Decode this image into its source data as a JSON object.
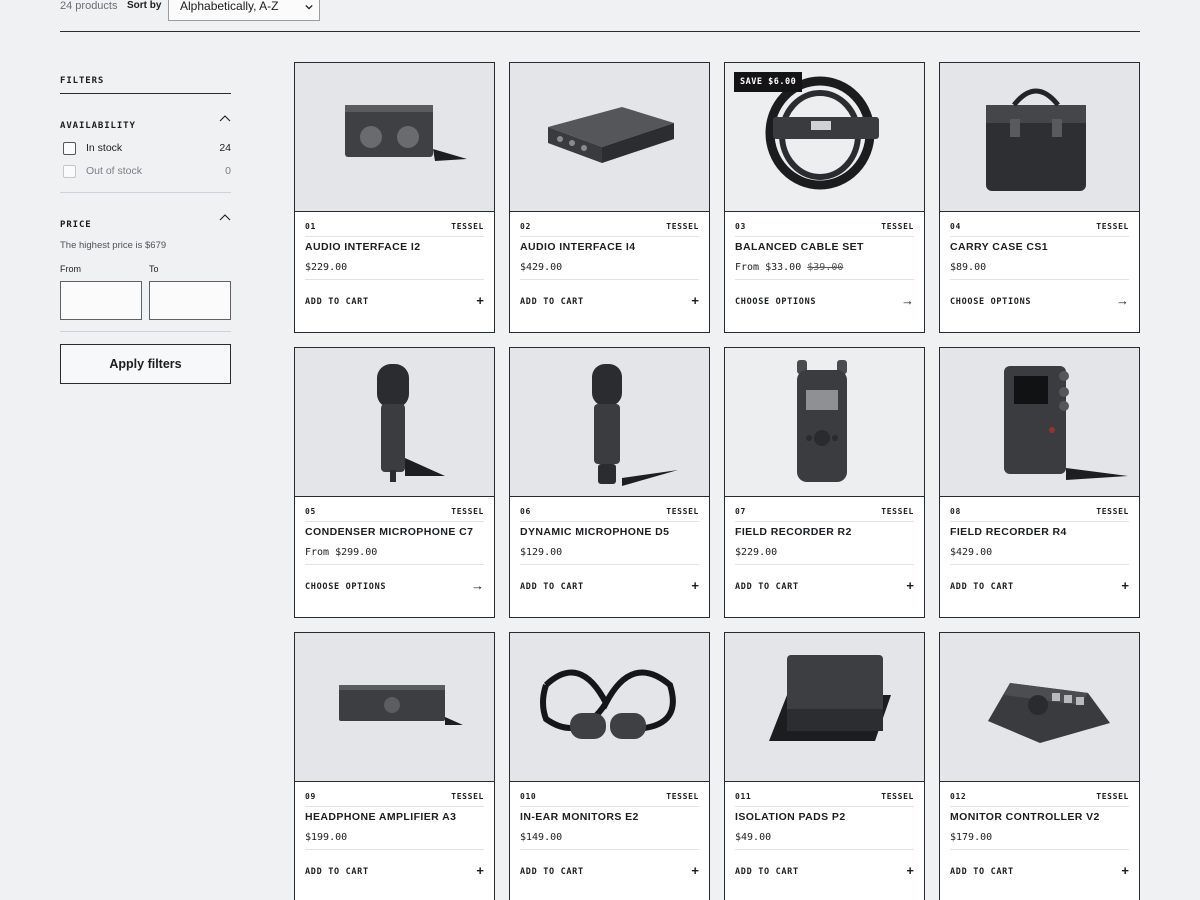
{
  "toolbar": {
    "product_count": "24 products",
    "sort_label": "Sort by",
    "sort_value": "Alphabetically, A-Z"
  },
  "filters": {
    "title": "FILTERS",
    "availability": {
      "title": "AVAILABILITY",
      "options": [
        {
          "label": "In stock",
          "count": "24"
        },
        {
          "label": "Out of stock",
          "count": "0"
        }
      ]
    },
    "price": {
      "title": "PRICE",
      "highest_text": "The highest price is $679",
      "from_label": "From",
      "to_label": "To",
      "from_value": "",
      "to_value": ""
    },
    "apply_label": "Apply filters"
  },
  "products": [
    {
      "num": "01",
      "brand": "TESSEL",
      "name": "AUDIO INTERFACE I2",
      "price": "$229.00",
      "cta": "ADD TO CART",
      "icon": "+",
      "badge": ""
    },
    {
      "num": "02",
      "brand": "TESSEL",
      "name": "AUDIO INTERFACE I4",
      "price": "$429.00",
      "cta": "ADD TO CART",
      "icon": "+",
      "badge": ""
    },
    {
      "num": "03",
      "brand": "TESSEL",
      "name": "BALANCED CABLE SET",
      "price": "From $33.00",
      "compare_price": "$39.00",
      "cta": "CHOOSE OPTIONS",
      "icon": "→",
      "badge": "SAVE $6.00"
    },
    {
      "num": "04",
      "brand": "TESSEL",
      "name": "CARRY CASE CS1",
      "price": "$89.00",
      "cta": "CHOOSE OPTIONS",
      "icon": "→",
      "badge": ""
    },
    {
      "num": "05",
      "brand": "TESSEL",
      "name": "CONDENSER MICROPHONE C7",
      "price": "From $299.00",
      "cta": "CHOOSE OPTIONS",
      "icon": "→",
      "badge": ""
    },
    {
      "num": "06",
      "brand": "TESSEL",
      "name": "DYNAMIC MICROPHONE D5",
      "price": "$129.00",
      "cta": "ADD TO CART",
      "icon": "+",
      "badge": ""
    },
    {
      "num": "07",
      "brand": "TESSEL",
      "name": "FIELD RECORDER R2",
      "price": "$229.00",
      "cta": "ADD TO CART",
      "icon": "+",
      "badge": ""
    },
    {
      "num": "08",
      "brand": "TESSEL",
      "name": "FIELD RECORDER R4",
      "price": "$429.00",
      "cta": "ADD TO CART",
      "icon": "+",
      "badge": ""
    },
    {
      "num": "09",
      "brand": "TESSEL",
      "name": "HEADPHONE AMPLIFIER A3",
      "price": "$199.00",
      "cta": "ADD TO CART",
      "icon": "+",
      "badge": ""
    },
    {
      "num": "010",
      "brand": "TESSEL",
      "name": "IN-EAR MONITORS E2",
      "price": "$149.00",
      "cta": "ADD TO CART",
      "icon": "+",
      "badge": ""
    },
    {
      "num": "011",
      "brand": "TESSEL",
      "name": "ISOLATION PADS P2",
      "price": "$49.00",
      "cta": "ADD TO CART",
      "icon": "+",
      "badge": ""
    },
    {
      "num": "012",
      "brand": "TESSEL",
      "name": "MONITOR CONTROLLER V2",
      "price": "$179.00",
      "cta": "ADD TO CART",
      "icon": "+",
      "badge": ""
    }
  ]
}
